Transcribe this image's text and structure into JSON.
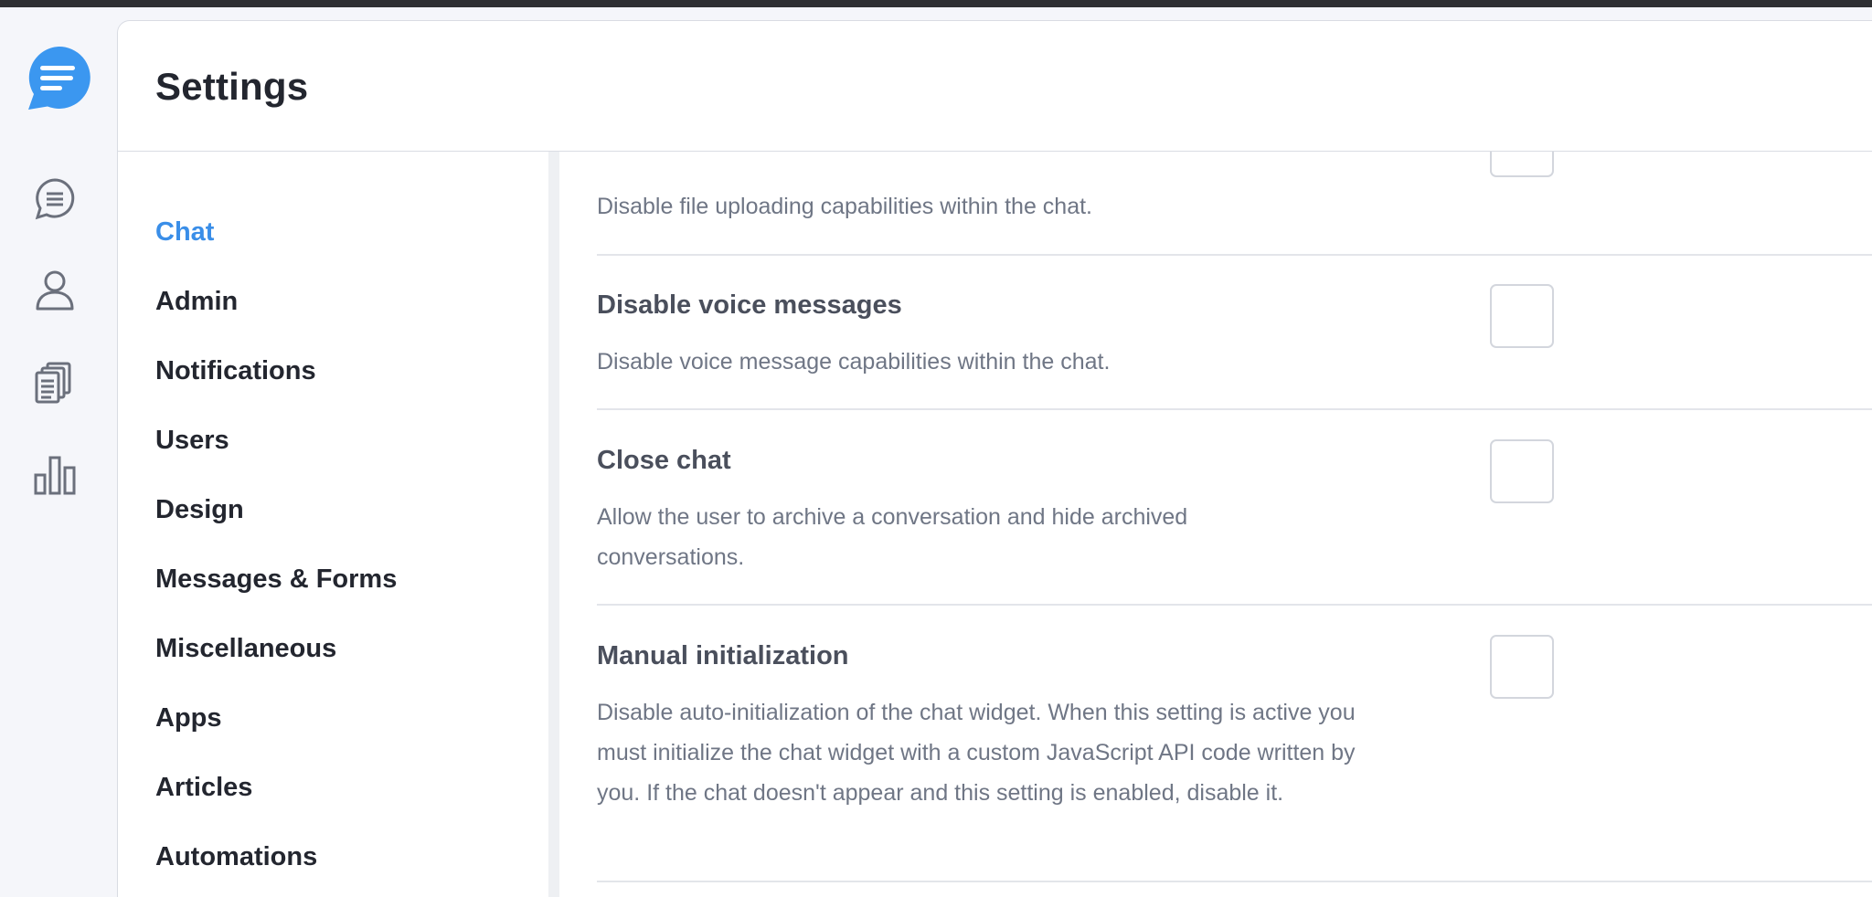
{
  "header": {
    "title": "Settings"
  },
  "rail": {
    "items": [
      {
        "icon": "conversations-icon"
      },
      {
        "icon": "user-icon"
      },
      {
        "icon": "documents-icon"
      },
      {
        "icon": "bar-chart-icon"
      }
    ]
  },
  "nav": {
    "items": [
      {
        "label": "Chat",
        "active": true
      },
      {
        "label": "Admin"
      },
      {
        "label": "Notifications"
      },
      {
        "label": "Users"
      },
      {
        "label": "Design"
      },
      {
        "label": "Messages & Forms"
      },
      {
        "label": "Miscellaneous"
      },
      {
        "label": "Apps"
      },
      {
        "label": "Articles"
      },
      {
        "label": "Automations"
      }
    ]
  },
  "settings": [
    {
      "title": "",
      "description": "Disable file uploading capabilities within the chat.",
      "checked": false
    },
    {
      "title": "Disable voice messages",
      "description": "Disable voice message capabilities within the chat.",
      "checked": false
    },
    {
      "title": "Close chat",
      "description": "Allow the user to archive a conversation and hide archived conversations.",
      "checked": false
    },
    {
      "title": "Manual initialization",
      "description": "Disable auto-initialization of the chat widget. When this setting is active you must initialize the chat widget with a custom JavaScript API code written by you. If the chat doesn't appear and this setting is enabled, disable it.",
      "checked": false
    }
  ],
  "colors": {
    "accent": "#3a8ee8",
    "logo": "#3b97f0"
  }
}
